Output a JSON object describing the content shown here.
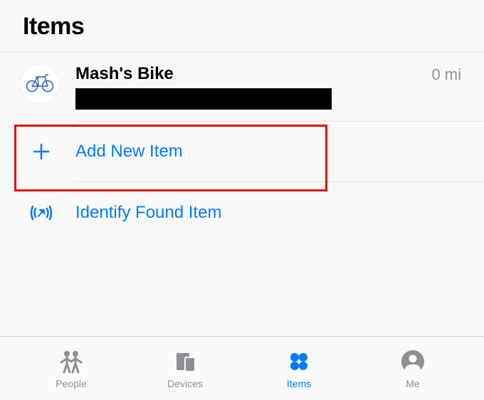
{
  "header": {
    "title": "Items"
  },
  "items": [
    {
      "name": "Mash's Bike",
      "distance": "0 mi"
    }
  ],
  "actions": {
    "add": "Add New Item",
    "identify": "Identify Found Item"
  },
  "tabs": {
    "people": "People",
    "devices": "Devices",
    "items": "Items",
    "me": "Me"
  },
  "colors": {
    "accent": "#007aff",
    "inactive": "#8e8e93"
  }
}
